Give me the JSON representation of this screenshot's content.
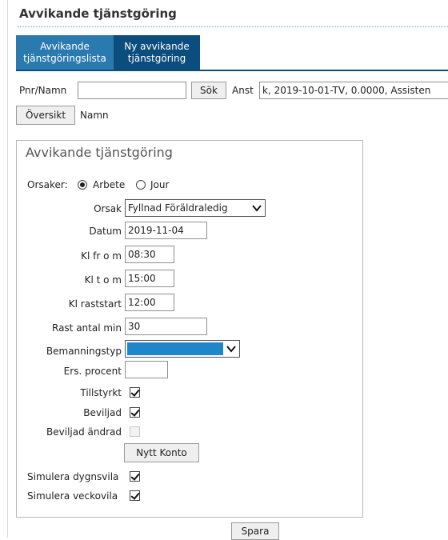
{
  "page": {
    "title": "Avvikande tjänstgöring"
  },
  "tabs": [
    {
      "line1": "Avvikande",
      "line2": "tjänstgöringslista"
    },
    {
      "line1": "Ny avvikande",
      "line2": "tjänstgöring"
    }
  ],
  "search": {
    "pnr_label": "Pnr/Namn",
    "pnr_value": "",
    "sok_label": "Sök",
    "anst_label": "Anst",
    "anst_value": "k, 2019-10-01-TV, 0.0000, Assisten"
  },
  "overview": {
    "button_label": "Översikt",
    "namn_label": "Namn",
    "namn_value": ""
  },
  "form": {
    "title": "Avvikande tjänstgöring",
    "orsaker_label": "Orsaker:",
    "radio_arbete": "Arbete",
    "radio_jour": "Jour",
    "orsak_label": "Orsak",
    "orsak_value": "Fyllnad Föräldraledig",
    "datum_label": "Datum",
    "datum_value": "2019-11-04",
    "klfrom_label": "Kl fr o m",
    "klfrom_value": "08:30",
    "kltom_label": "Kl t o m",
    "kltom_value": "15:00",
    "rast_label": "Kl raststart",
    "rast_value": "12:00",
    "rastmin_label": "Rast antal min",
    "rastmin_value": "30",
    "bemanning_label": "Bemanningstyp",
    "bemanning_value": "",
    "ers_label": "Ers. procent",
    "ers_value": "",
    "tillstyrkt_label": "Tillstyrkt",
    "beviljad_label": "Beviljad",
    "beviljad_andrad_label": "Beviljad ändrad",
    "nytt_konto_label": "Nytt Konto",
    "sim_dygn_label": "Simulera dygnsvila",
    "sim_vecka_label": "Simulera veckovila"
  },
  "actions": {
    "spara_label": "Spara"
  },
  "colors": {
    "tab_active": "#0b4d7d",
    "tab_inactive": "#2a7ab0",
    "selection_fill": "#1f86c9"
  }
}
